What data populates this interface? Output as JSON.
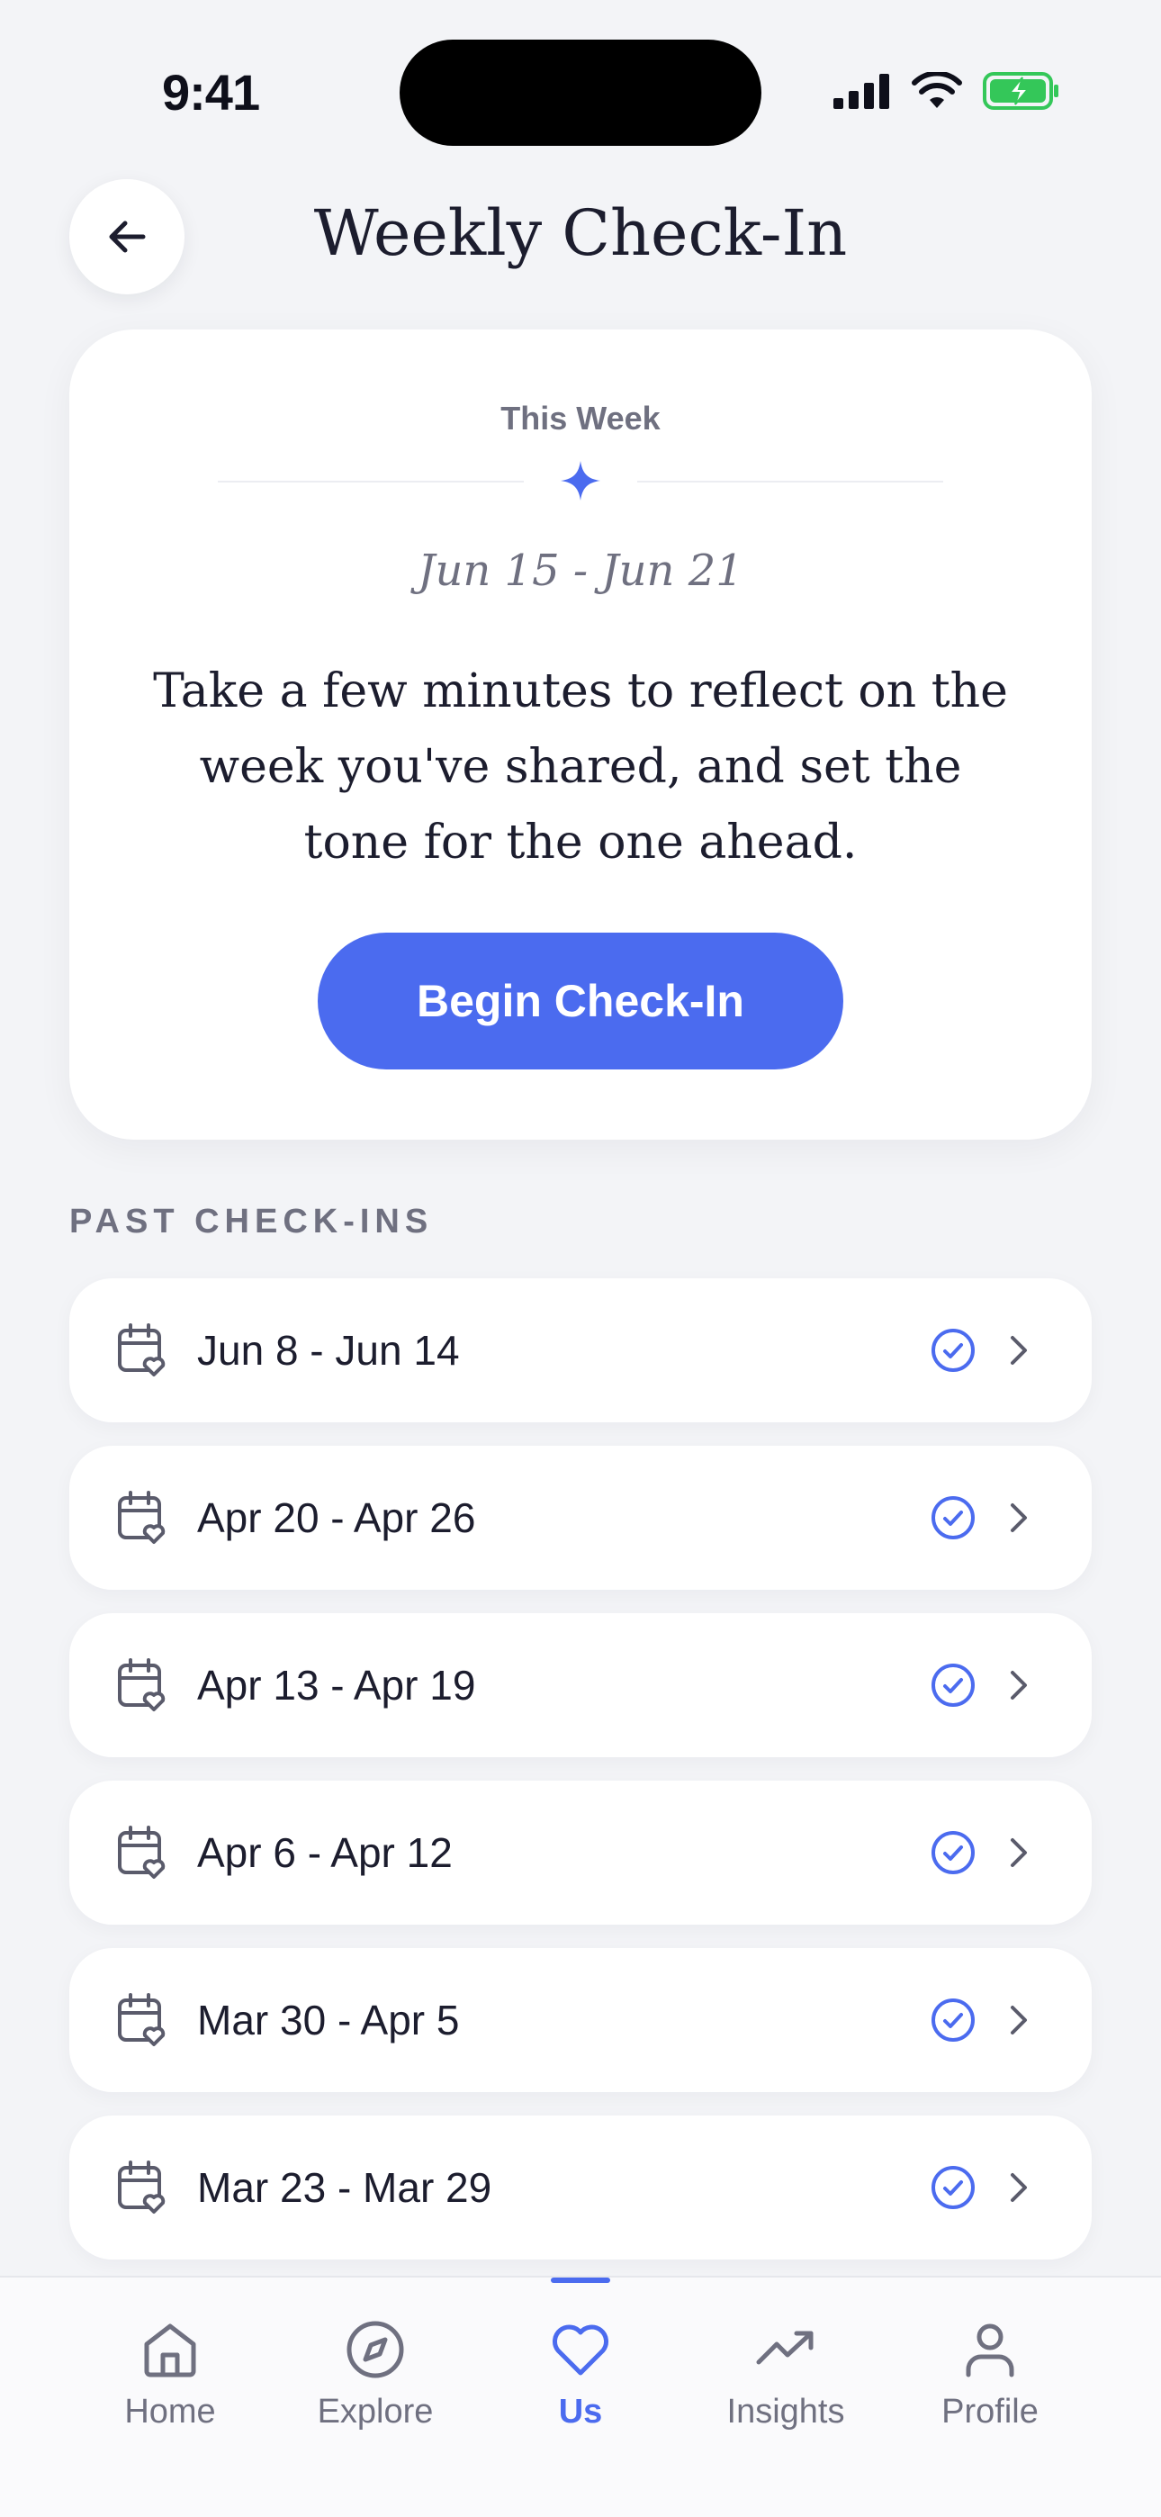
{
  "status_bar": {
    "time": "9:41"
  },
  "header": {
    "title": "Weekly Check-In",
    "back_icon": "arrow-left-icon"
  },
  "hero": {
    "eyebrow": "This Week",
    "date_range": "Jun 15 - Jun 21",
    "body": "Take a few minutes to reflect on the week you've shared, and set the tone for the one ahead.",
    "cta_label": "Begin Check-In"
  },
  "past": {
    "section_label": "PAST CHECK-INS",
    "items": [
      {
        "label": "Jun 8 - Jun 14",
        "completed": true
      },
      {
        "label": "Apr 20 - Apr 26",
        "completed": true
      },
      {
        "label": "Apr 13 - Apr 19",
        "completed": true
      },
      {
        "label": "Apr 6 - Apr 12",
        "completed": true
      },
      {
        "label": "Mar 30 - Apr 5",
        "completed": true
      },
      {
        "label": "Mar 23 - Mar 29",
        "completed": true
      }
    ]
  },
  "tabs": [
    {
      "label": "Home",
      "icon": "home-icon",
      "active": false
    },
    {
      "label": "Explore",
      "icon": "compass-icon",
      "active": false
    },
    {
      "label": "Us",
      "icon": "heart-icon",
      "active": true
    },
    {
      "label": "Insights",
      "icon": "trend-icon",
      "active": false
    },
    {
      "label": "Profile",
      "icon": "person-icon",
      "active": false
    }
  ],
  "colors": {
    "accent": "#4B6BEF",
    "background": "#F3F4F7",
    "card": "#FFFFFF",
    "text_primary": "#1C1D2E",
    "text_secondary": "#6F7080",
    "battery": "#34C759"
  }
}
